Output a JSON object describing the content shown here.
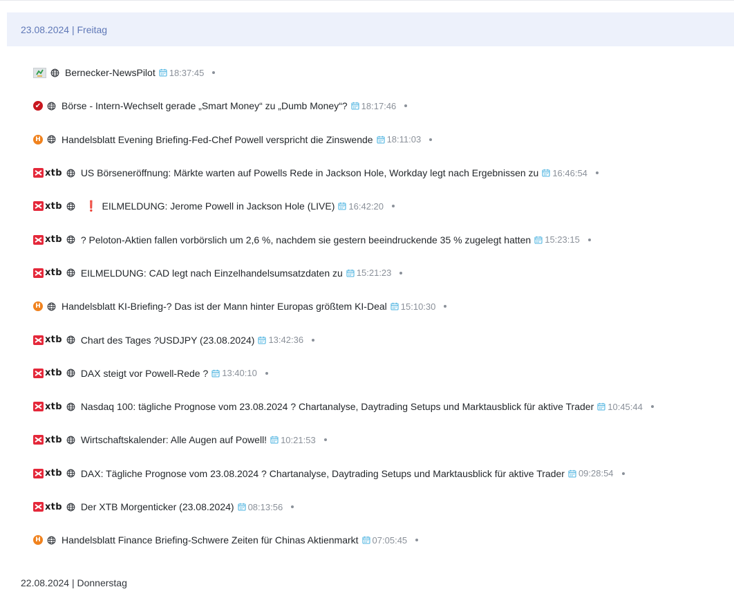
{
  "days": [
    {
      "label": "23.08.2024 | Freitag",
      "active": true,
      "items": [
        {
          "source": "bernecker",
          "title": "Bernecker-NewsPilot",
          "time": "18:37:45",
          "alert": false
        },
        {
          "source": "check",
          "title": "Börse - Intern-Wechselt gerade „Smart Money“ zu „Dumb Money“?",
          "time": "18:17:46",
          "alert": false
        },
        {
          "source": "handelsblatt",
          "title": "Handelsblatt Evening Briefing-Fed-Chef Powell verspricht die Zinswende",
          "time": "18:11:03",
          "alert": false
        },
        {
          "source": "xtb",
          "title": "US Börseneröffnung: Märkte warten auf Powells Rede in Jackson Hole, Workday legt nach Ergebnissen zu",
          "time": "16:46:54",
          "alert": false
        },
        {
          "source": "xtb",
          "title": "EILMELDUNG: Jerome Powell in Jackson Hole (LIVE)",
          "time": "16:42:20",
          "alert": true
        },
        {
          "source": "xtb",
          "title": "? Peloton-Aktien fallen vorbörslich um 2,6 %, nachdem sie gestern beeindruckende 35 % zugelegt hatten",
          "time": "15:23:15",
          "alert": false
        },
        {
          "source": "xtb",
          "title": "EILMELDUNG: CAD legt nach Einzelhandelsumsatzdaten zu",
          "time": "15:21:23",
          "alert": false
        },
        {
          "source": "handelsblatt",
          "title": "Handelsblatt KI-Briefing-? Das ist der Mann hinter Europas größtem KI-Deal",
          "time": "15:10:30",
          "alert": false
        },
        {
          "source": "xtb",
          "title": "Chart des Tages ?USDJPY (23.08.2024)",
          "time": "13:42:36",
          "alert": false
        },
        {
          "source": "xtb",
          "title": "DAX steigt vor Powell-Rede ?",
          "time": "13:40:10",
          "alert": false
        },
        {
          "source": "xtb",
          "title": "Nasdaq 100: tägliche Prognose vom 23.08.2024 ? Chartanalyse, Daytrading Setups und Marktausblick für aktive Trader",
          "time": "10:45:44",
          "alert": false
        },
        {
          "source": "xtb",
          "title": "Wirtschaftskalender: Alle Augen auf Powell!",
          "time": "10:21:53",
          "alert": false
        },
        {
          "source": "xtb",
          "title": "DAX: Tägliche Prognose vom 23.08.2024 ? Chartanalyse, Daytrading Setups und Marktausblick für aktive Trader",
          "time": "09:28:54",
          "alert": false
        },
        {
          "source": "xtb",
          "title": "Der XTB Morgenticker (23.08.2024)",
          "time": "08:13:56",
          "alert": false
        },
        {
          "source": "handelsblatt",
          "title": "Handelsblatt Finance Briefing-Schwere Zeiten für Chinas Aktienmarkt",
          "time": "07:05:45",
          "alert": false
        }
      ]
    },
    {
      "label": "22.08.2024 | Donnerstag",
      "active": false,
      "items": []
    }
  ],
  "logos": {
    "xtb": "xtb",
    "handelsblatt": "H",
    "check": "✔"
  },
  "icons": {
    "globe": "globe-icon",
    "calendar": "calendar-icon",
    "alert": "❗"
  },
  "colors": {
    "header_bg": "#edf1fb",
    "header_text": "#5f78b7",
    "calendar_icon": "#4cb3e0",
    "xtb_red": "#e4283a",
    "handelsblatt_orange": "#f0821e",
    "check_red": "#c8171f",
    "alert_red": "#e0162b",
    "time_text": "#8a9099"
  }
}
